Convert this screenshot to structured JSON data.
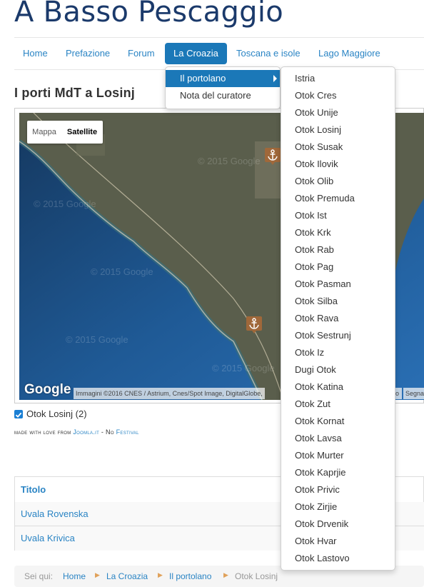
{
  "site": {
    "title": "A Basso Pescaggio"
  },
  "nav": {
    "items": [
      {
        "label": "Home"
      },
      {
        "label": "Prefazione"
      },
      {
        "label": "Forum"
      },
      {
        "label": "La Croazia"
      },
      {
        "label": "Toscana e isole"
      },
      {
        "label": "Lago Maggiore"
      }
    ],
    "active": "La Croazia"
  },
  "dropdown": {
    "items": [
      {
        "label": "Il portolano"
      },
      {
        "label": "Nota del curatore"
      }
    ]
  },
  "submenu": {
    "items": [
      "Istria",
      "Otok Cres",
      "Otok Unije",
      "Otok Losinj",
      "Otok Susak",
      "Otok Ilovik",
      "Otok Olib",
      "Otok Premuda",
      "Otok Ist",
      "Otok Krk",
      "Otok Rab",
      "Otok Pag",
      "Otok Pasman",
      "Otok Silba",
      "Otok Rava",
      "Otok Sestrunj",
      "Otok Iz",
      "Dugi Otok",
      "Otok Katina",
      "Otok Zut",
      "Otok Kornat",
      "Otok Lavsa",
      "Otok Murter",
      "Otok Kaprjie",
      "Otok Privic",
      "Otok Zirjie",
      "Otok Drvenik",
      "Otok Hvar",
      "Otok Lastovo"
    ]
  },
  "page": {
    "heading": "I porti MdT a Losinj"
  },
  "map": {
    "type_control": {
      "mappa": "Mappa",
      "satellite": "Satellite",
      "selected": "Satellite"
    },
    "google": "Google",
    "watermarks": [
      "© 2015 Google",
      "© 2015 Google",
      "© 2015 Google",
      "© 2015 Google",
      "© 2015 Google"
    ],
    "attribution": "Immagini ©2016 CNES / Astrium, Cnes/Spot Image, DigitalGlobe,",
    "attribution_tail": "Segna",
    "attribution_mid": "o",
    "marker_icon": "anchor-icon",
    "colors": {
      "sea": "#1f4f86",
      "land": "#5a5e4c",
      "marker": "#a0683a"
    }
  },
  "layer": {
    "label": "Otok Losinj (2)",
    "checked": true
  },
  "credit": {
    "prefix": "made with love from",
    "joomla": "Joomla.it",
    "sep": "-",
    "no": "No",
    "festival": "Festival"
  },
  "table": {
    "header": "Titolo",
    "rows": [
      "Uvala Rovenska",
      "Uvala Krivica"
    ]
  },
  "breadcrumb": {
    "label": "Sei qui:",
    "items": [
      "Home",
      "La Croazia",
      "Il portolano",
      "Otok Losinj"
    ]
  },
  "colors": {
    "accent": "#1b78b8",
    "link": "#2a84c4",
    "title": "#1b3a6b"
  }
}
